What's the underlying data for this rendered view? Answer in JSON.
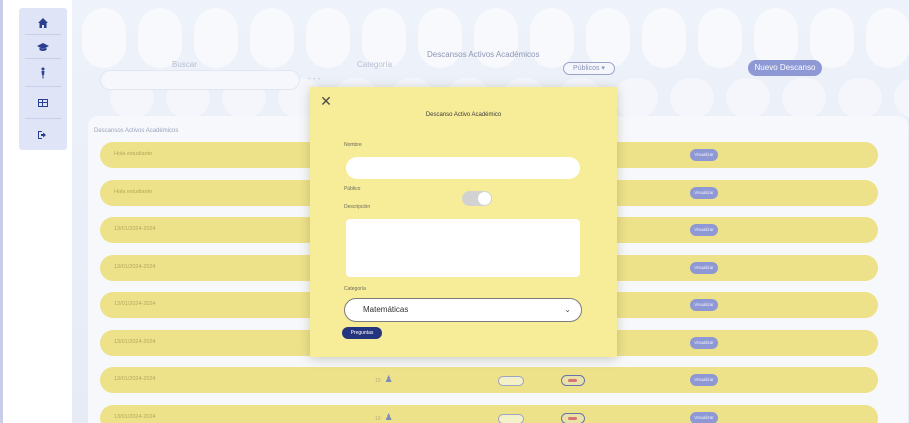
{
  "sidebar": {
    "items": [
      {
        "icon": "home-icon"
      },
      {
        "icon": "school-icon"
      },
      {
        "icon": "person-icon"
      },
      {
        "icon": "dashboard-icon"
      },
      {
        "icon": "logout-icon"
      }
    ]
  },
  "filters": {
    "search_label": "Buscar",
    "category_label": "Categoría",
    "category_value": "- - -"
  },
  "header": {
    "title": "Descansos Activos Académicos",
    "public_button": "Públicos ▾",
    "new_button": "Nuevo Descanso"
  },
  "list": {
    "title": "Descansos Activos Académicos",
    "rows": [
      {
        "label": "Hola estudiante",
        "action": "Visualizar"
      },
      {
        "label": "Hola estudiante",
        "action": "Visualizar"
      },
      {
        "label": "13/01/2024-2024",
        "action": "Visualizar"
      },
      {
        "label": "13/01/2024-2024",
        "action": "Visualizar"
      },
      {
        "label": "13/01/2024-2024",
        "action": "Visualizar"
      },
      {
        "label": "13/01/2024-2024",
        "action": "Visualizar"
      },
      {
        "label": "13/01/2024-2024",
        "action": "Visualizar",
        "count": "10"
      },
      {
        "label": "13/01/2024-2024",
        "action": "Visualizar",
        "count": "10"
      }
    ]
  },
  "modal": {
    "title": "Descanso Activo Académico",
    "nombre_label": "Nombre",
    "publico_label": "Público",
    "descripcion_label": "Descripción",
    "categoria_label": "Categoría",
    "categoria_value": "Matemáticas",
    "preguntas_button": "Preguntas",
    "close_symbol": "✕"
  },
  "colors": {
    "row_bg": "#ede18a",
    "modal_bg": "#f7ec98",
    "accent": "#8e98d4",
    "dark_blue": "#24357f"
  }
}
